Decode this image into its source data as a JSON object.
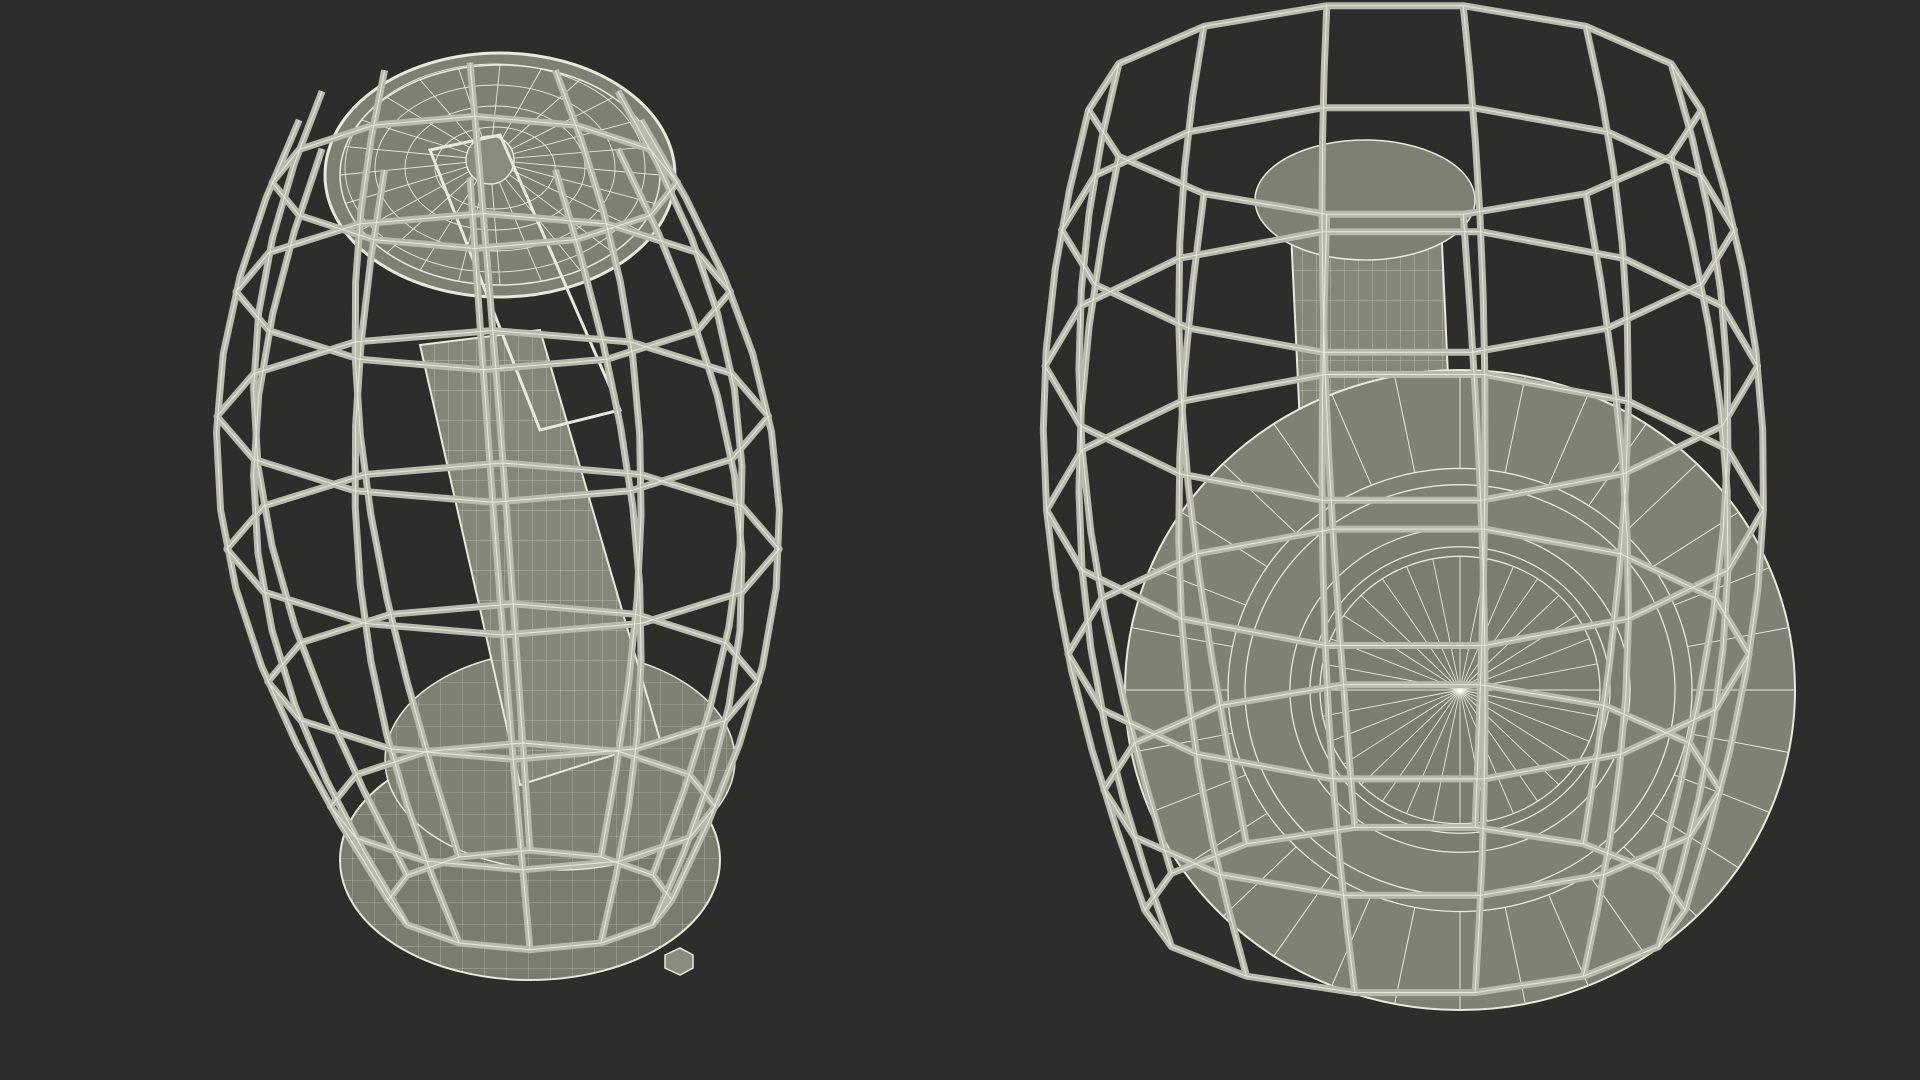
{
  "scene": {
    "background_color": "#2d2d2c",
    "wire_color": "#e8e8dc",
    "surface_color": "#7d7d72",
    "cage_color": "#b7b7ab",
    "objects": [
      {
        "name": "caged-lamp-side-view",
        "view": "angled-top"
      },
      {
        "name": "caged-lamp-bottom-view",
        "view": "bottom"
      }
    ]
  }
}
